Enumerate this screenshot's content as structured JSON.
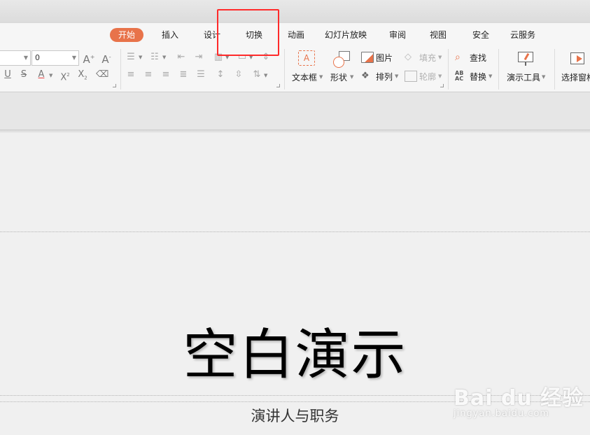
{
  "tabs": [
    {
      "label": "开始",
      "active": true
    },
    {
      "label": "插入"
    },
    {
      "label": "设计"
    },
    {
      "label": "切换"
    },
    {
      "label": "动画"
    },
    {
      "label": "幻灯片放映"
    },
    {
      "label": "审阅"
    },
    {
      "label": "视图"
    },
    {
      "label": "安全"
    },
    {
      "label": "云服务"
    }
  ],
  "ribbon": {
    "font_size_value": "0",
    "text_box": "文本框",
    "shape": "形状",
    "picture": "图片",
    "arrange": "排列",
    "fill": "填充",
    "outline": "轮廓",
    "find": "查找",
    "replace": "替换",
    "present_tools": "演示工具",
    "select_pane": "选择窗格"
  },
  "slide": {
    "title": "空白演示",
    "subtitle": "演讲人与职务"
  },
  "watermark": {
    "brand": "Bai du 经验",
    "url": "jingyan.baidu.com"
  },
  "colors": {
    "accent": "#e8734a",
    "highlight": "#ff2a2a"
  }
}
